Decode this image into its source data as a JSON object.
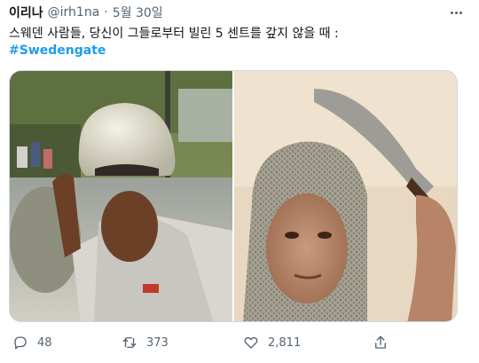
{
  "tweet": {
    "author_name": "이리나",
    "handle": "@irh1na",
    "separator": "·",
    "date": "5월 30일",
    "text": "스웨덴 사람들, 당신이 그들로부터 빌린 5 센트를 갚지 않을 때 :",
    "hashtag": "#Swedengate"
  },
  "media": {
    "left_image": "photo-man-helmet",
    "right_image": "photo-woman-chainmail-sword"
  },
  "actions": {
    "reply_count": "48",
    "retweet_count": "373",
    "like_count": "2,811"
  },
  "colors": {
    "accent": "#1d9bf0",
    "muted": "#536471",
    "text": "#0f1419"
  }
}
